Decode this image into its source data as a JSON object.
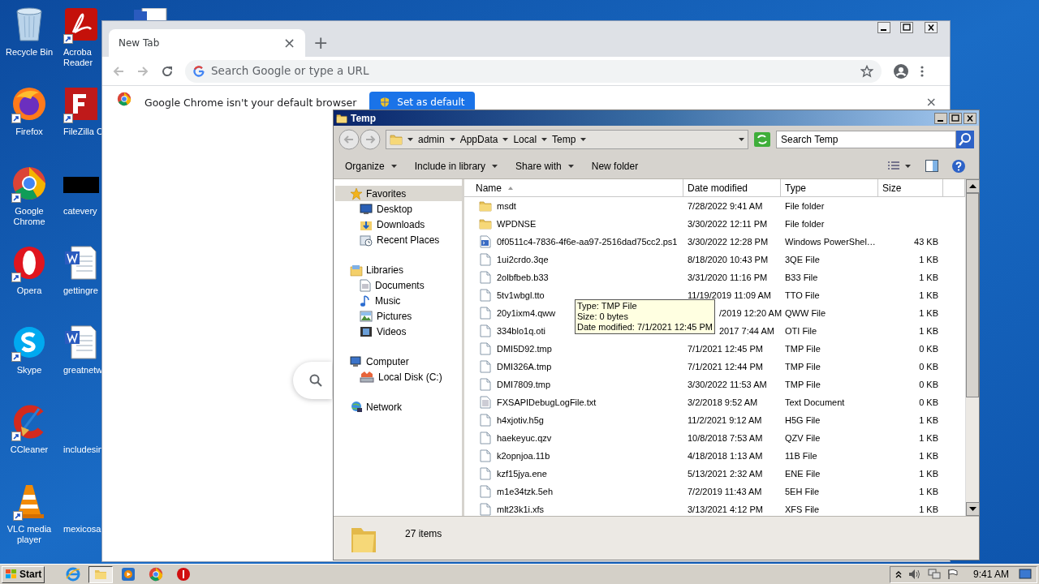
{
  "desktop": {
    "icons": [
      {
        "lines": [
          "Recycle Bin"
        ],
        "kind": "recycle",
        "shortcut": false
      },
      {
        "lines": [
          "Firefox"
        ],
        "kind": "firefox",
        "shortcut": true
      },
      {
        "lines": [
          "Google",
          "Chrome"
        ],
        "kind": "chrome",
        "shortcut": true
      },
      {
        "lines": [
          "Opera"
        ],
        "kind": "opera",
        "shortcut": true
      },
      {
        "lines": [
          "Skype"
        ],
        "kind": "skype",
        "shortcut": true
      },
      {
        "lines": [
          "CCleaner"
        ],
        "kind": "ccleaner",
        "shortcut": true
      },
      {
        "lines": [
          "VLC media",
          "player"
        ],
        "kind": "vlc",
        "shortcut": true
      }
    ],
    "icons_column_2": [
      {
        "lines": [
          "Acroba",
          "Reader"
        ],
        "kind": "acrobat",
        "shortcut": true
      },
      {
        "lines": [
          "FileZilla C"
        ],
        "kind": "filezilla",
        "shortcut": true
      },
      {
        "lines": [
          "catevery"
        ],
        "kind": "thumbnail",
        "shortcut": false
      },
      {
        "lines": [
          "gettingre"
        ],
        "kind": "word",
        "shortcut": false
      },
      {
        "lines": [
          "greatnetw"
        ],
        "kind": "word",
        "shortcut": false
      },
      {
        "lines": [
          "includesin"
        ],
        "kind": "blank",
        "shortcut": false
      },
      {
        "lines": [
          "mexicosa"
        ],
        "kind": "blank",
        "shortcut": false
      }
    ]
  },
  "browser": {
    "tab": {
      "title": "New Tab",
      "close": "×"
    },
    "new_tab": "+",
    "omnibox": {
      "placeholder": "Search Google or type a URL"
    },
    "infobar": {
      "message": "Google Chrome isn't your default browser",
      "button": "Set as default",
      "close": "×"
    }
  },
  "explorer": {
    "title": "Temp",
    "breadcrumb": [
      "admin",
      "AppData",
      "Local",
      "Temp"
    ],
    "search": {
      "placeholder": "Search Temp"
    },
    "commands": [
      {
        "label": "Organize",
        "menu": true
      },
      {
        "label": "Include in library",
        "menu": true
      },
      {
        "label": "Share with",
        "menu": true
      },
      {
        "label": "New folder",
        "menu": false
      }
    ],
    "navigation": [
      {
        "label": "Favorites",
        "kind": "star",
        "selected": true,
        "children": [
          {
            "label": "Desktop",
            "kind": "desktop"
          },
          {
            "label": "Downloads",
            "kind": "downloads"
          },
          {
            "label": "Recent Places",
            "kind": "recent"
          }
        ]
      },
      {
        "label": "Libraries",
        "kind": "libraries",
        "selected": false,
        "children": [
          {
            "label": "Documents",
            "kind": "documents"
          },
          {
            "label": "Music",
            "kind": "music"
          },
          {
            "label": "Pictures",
            "kind": "pictures"
          },
          {
            "label": "Videos",
            "kind": "videos"
          }
        ]
      },
      {
        "label": "Computer",
        "kind": "computer",
        "selected": false,
        "children": [
          {
            "label": "Local Disk (C:)",
            "kind": "disk"
          }
        ]
      },
      {
        "label": "Network",
        "kind": "network",
        "selected": false
      }
    ],
    "columns": [
      {
        "label": "Name",
        "sorted": true
      },
      {
        "label": "Date modified",
        "sorted": false
      },
      {
        "label": "Type",
        "sorted": false
      },
      {
        "label": "Size",
        "sorted": false
      }
    ],
    "rows": [
      {
        "name": "msdt",
        "kind": "folder",
        "date": "7/28/2022 9:41 AM",
        "type": "File folder",
        "size": "",
        "covered": false
      },
      {
        "name": "WPDNSE",
        "kind": "folder",
        "date": "3/30/2022 12:11 PM",
        "type": "File folder",
        "size": "",
        "covered": false
      },
      {
        "name": "0f0511c4-7836-4f6e-aa97-2516dad75cc2.ps1",
        "kind": "script",
        "date": "3/30/2022 12:28 PM",
        "type": "Windows PowerShel…",
        "size": "43 KB",
        "covered": false
      },
      {
        "name": "1ui2crdo.3qe",
        "kind": "file",
        "date": "8/18/2020 10:43 PM",
        "type": "3QE File",
        "size": "1 KB",
        "covered": false
      },
      {
        "name": "2olbfbeb.b33",
        "kind": "file",
        "date": "3/31/2020 11:16 PM",
        "type": "B33 File",
        "size": "1 KB",
        "covered": false
      },
      {
        "name": "5tv1wbgl.tto",
        "kind": "file",
        "date": "11/19/2019 11:09 AM",
        "type": "TTO File",
        "size": "1 KB",
        "covered": false
      },
      {
        "name": "20y1ixm4.qww",
        "kind": "file",
        "date": "/2019 12:20 AM",
        "type": "QWW File",
        "size": "1 KB",
        "covered": true
      },
      {
        "name": "334blo1q.oti",
        "kind": "file",
        "date": "2017 7:44 AM",
        "type": "OTI File",
        "size": "1 KB",
        "covered": true
      },
      {
        "name": "DMI5D92.tmp",
        "kind": "file",
        "date": "7/1/2021 12:45 PM",
        "type": "TMP File",
        "size": "0 KB",
        "covered": false
      },
      {
        "name": "DMI326A.tmp",
        "kind": "file",
        "date": "7/1/2021 12:44 PM",
        "type": "TMP File",
        "size": "0 KB",
        "covered": false
      },
      {
        "name": "DMI7809.tmp",
        "kind": "file",
        "date": "3/30/2022 11:53 AM",
        "type": "TMP File",
        "size": "0 KB",
        "covered": false
      },
      {
        "name": "FXSAPIDebugLogFile.txt",
        "kind": "text",
        "date": "3/2/2018 9:52 AM",
        "type": "Text Document",
        "size": "0 KB",
        "covered": false
      },
      {
        "name": "h4xjotiv.h5g",
        "kind": "file",
        "date": "11/2/2021 9:12 AM",
        "type": "H5G File",
        "size": "1 KB",
        "covered": false
      },
      {
        "name": "haekeyuc.qzv",
        "kind": "file",
        "date": "10/8/2018 7:53 AM",
        "type": "QZV File",
        "size": "1 KB",
        "covered": false
      },
      {
        "name": "k2opnjoa.11b",
        "kind": "file",
        "date": "4/18/2018 1:13 AM",
        "type": "11B File",
        "size": "1 KB",
        "covered": false
      },
      {
        "name": "kzf15jya.ene",
        "kind": "file",
        "date": "5/13/2021 2:32 AM",
        "type": "ENE File",
        "size": "1 KB",
        "covered": false
      },
      {
        "name": "m1e34tzk.5eh",
        "kind": "file",
        "date": "7/2/2019 11:43 AM",
        "type": "5EH File",
        "size": "1 KB",
        "covered": false
      },
      {
        "name": "mlt23k1i.xfs",
        "kind": "file",
        "date": "3/13/2021 4:12 PM",
        "type": "XFS File",
        "size": "1 KB",
        "covered": false
      }
    ],
    "tooltip": [
      "Type: TMP File",
      "Size: 0 bytes",
      "Date modified: 7/1/2021 12:45 PM"
    ],
    "status": "27 items"
  },
  "taskbar": {
    "start": "Start",
    "apps": [
      {
        "kind": "ie",
        "selected": false
      },
      {
        "kind": "explorer",
        "selected": true
      },
      {
        "kind": "media",
        "selected": false
      },
      {
        "kind": "chrome",
        "selected": false
      },
      {
        "kind": "opera",
        "selected": false
      }
    ],
    "clock": "9:41 AM"
  }
}
